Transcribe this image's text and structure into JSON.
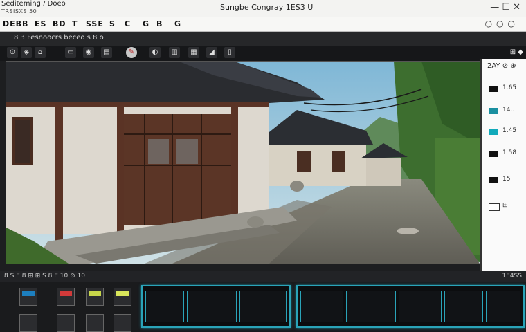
{
  "titlebar": {
    "app_label": "Sediteming / Doeo",
    "sub_label": "TRSISXS 50",
    "window_title": "Sungbe Congray 1ES3 U",
    "controls": "— ☐ ✕"
  },
  "menubar": {
    "items": [
      "DEBB",
      "ES",
      "BD",
      "T",
      "SSE",
      "S",
      "C",
      "G",
      "B",
      "G"
    ],
    "right_controls": "○○○"
  },
  "strip": {
    "left_text": "8 3 Fesnoocrs  beceo  s  8 o"
  },
  "toolbar": {
    "tools": [
      "⊙",
      "◈",
      "⌂",
      "▭",
      "◉",
      "▤",
      "✎",
      "◐",
      "▥",
      "▦",
      "◢",
      "▯"
    ],
    "active_index": 6,
    "right_label": "⊞ ◆"
  },
  "viewport": {
    "scene": "hanok-village-street"
  },
  "right_panel": {
    "header": "2AY  ⊘ ⊕",
    "layers": [
      {
        "label": "1.65",
        "color": "#111111"
      },
      {
        "label": "14..",
        "color": "#1a8fa0"
      },
      {
        "label": "1.45",
        "color": "#11aabb"
      },
      {
        "label": "1 58",
        "color": "#111111"
      },
      {
        "label": "15",
        "color": "#111111"
      },
      {
        "label": "⊞",
        "color": "#ffffff"
      }
    ]
  },
  "bottom": {
    "header_left": "8  S  E  8  ⊞  ⊞  S  8  E  10  ⊙  10",
    "header_right": "1E4SS",
    "swatches": [
      {
        "label": "",
        "fill": "#1d7fbf"
      },
      {
        "label": "",
        "fill": "#d23a3a"
      },
      {
        "label": "",
        "fill": "#c7d64a"
      },
      {
        "label": "",
        "fill": "#d8e55a"
      }
    ]
  }
}
